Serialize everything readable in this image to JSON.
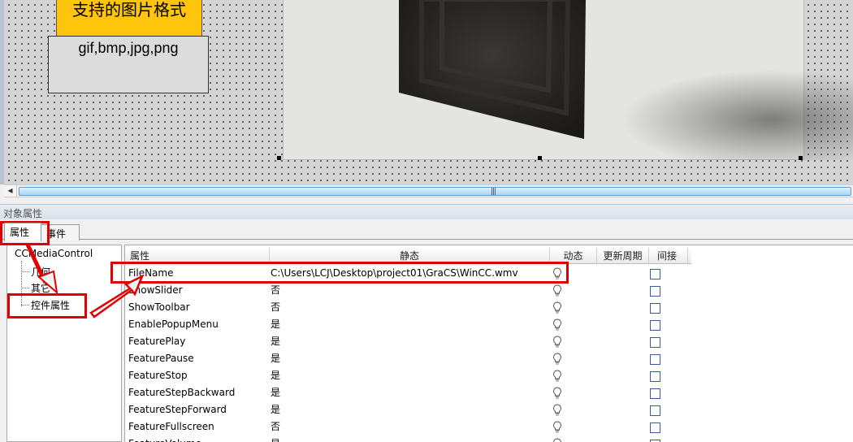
{
  "canvas": {
    "format_label": "支持的图片格式",
    "format_list": "gif,bmp,jpg,png"
  },
  "panel": {
    "title": "对象属性",
    "tabs": [
      {
        "label": "属性",
        "active": true
      },
      {
        "label": "事件",
        "active": false
      }
    ]
  },
  "tree": {
    "root": "CCMediaControl",
    "items": [
      "几何",
      "其它",
      "控件属性"
    ]
  },
  "grid": {
    "headers": [
      "属性",
      "静态",
      "动态",
      "更新周期",
      "间接"
    ],
    "rows": [
      {
        "name": "FileName",
        "static": "C:\\Users\\LCJ\\Desktop\\project01\\GraCS\\WinCC.wmv"
      },
      {
        "name": "ShowSlider",
        "static": "否"
      },
      {
        "name": "ShowToolbar",
        "static": "否"
      },
      {
        "name": "EnablePopupMenu",
        "static": "是"
      },
      {
        "name": "FeaturePlay",
        "static": "是"
      },
      {
        "name": "FeaturePause",
        "static": "是"
      },
      {
        "name": "FeatureStop",
        "static": "是"
      },
      {
        "name": "FeatureStepBackward",
        "static": "是"
      },
      {
        "name": "FeatureStepForward",
        "static": "是"
      },
      {
        "name": "FeatureFullscreen",
        "static": "否"
      },
      {
        "name": "FeatureVolume",
        "static": "是"
      }
    ]
  },
  "colors": {
    "annotation": "#e10000",
    "label_bg": "#ffc40c",
    "scroll_thumb": "#a9d6f7"
  },
  "icons": {
    "dynamic": "lightbulb-icon",
    "indirect": "checkbox"
  }
}
